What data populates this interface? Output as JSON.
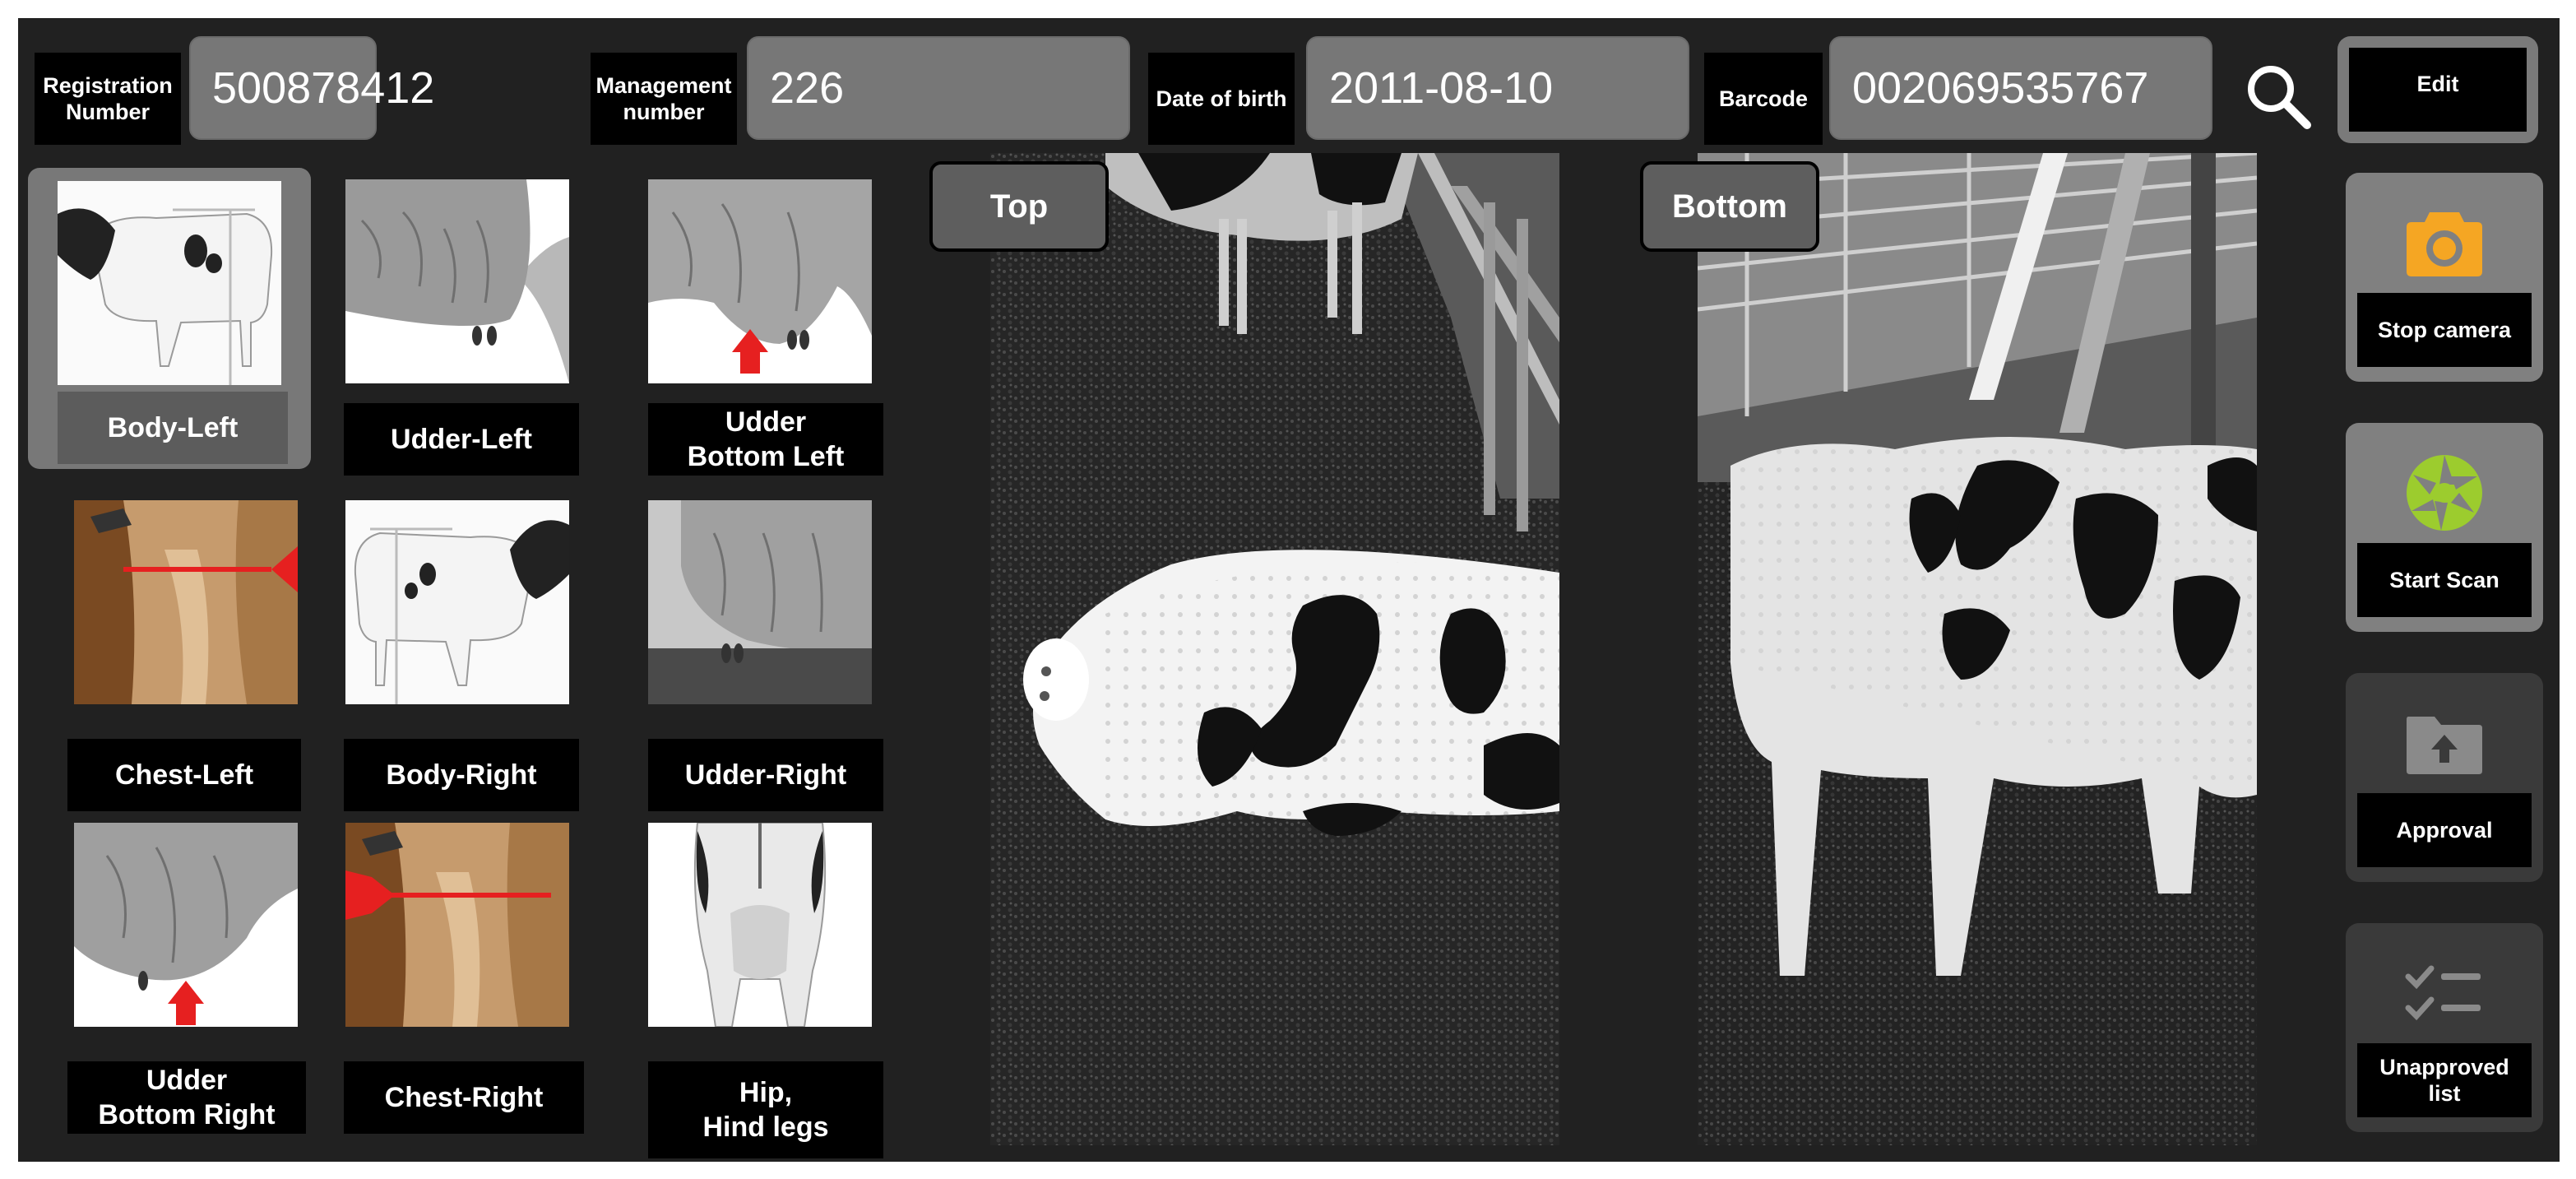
{
  "header": {
    "registration": {
      "label": "Registration\nNumber",
      "value": "500878412"
    },
    "management": {
      "label": "Management\nnumber",
      "value": "226"
    },
    "birth": {
      "label": "Date of birth",
      "value": "2011-08-10"
    },
    "barcode": {
      "label": "Barcode",
      "value": "002069535767"
    },
    "search_icon": "search-icon",
    "edit_label": "Edit"
  },
  "thumbnails": [
    {
      "label": "Body-Left",
      "image": "cow-body-left",
      "selected": true
    },
    {
      "label": "Udder-Left",
      "image": "udder-left"
    },
    {
      "label": "Udder\nBottom Left",
      "image": "udder-bottom-left"
    },
    {
      "label": "Chest-Left",
      "image": "chest-left"
    },
    {
      "label": "Body-Right",
      "image": "cow-body-right"
    },
    {
      "label": "Udder-Right",
      "image": "udder-right"
    },
    {
      "label": "Udder\nBottom Right",
      "image": "udder-bottom-right"
    },
    {
      "label": "Chest-Right",
      "image": "chest-right"
    },
    {
      "label": "Hip,\nHind legs",
      "image": "hip-hind-legs"
    }
  ],
  "views": {
    "top": {
      "label": "Top"
    },
    "bottom": {
      "label": "Bottom"
    }
  },
  "side_buttons": {
    "camera": {
      "label": "Stop camera",
      "icon": "camera-icon",
      "color": "#f5a623"
    },
    "scan": {
      "label": "Start Scan",
      "icon": "aperture-icon",
      "color": "#9ccc2e"
    },
    "approval": {
      "label": "Approval",
      "icon": "folder-upload-icon",
      "color": "#8a8a8a"
    },
    "unapproved": {
      "label": "Unapproved\nlist",
      "icon": "checklist-icon",
      "color": "#8a8a8a"
    }
  }
}
